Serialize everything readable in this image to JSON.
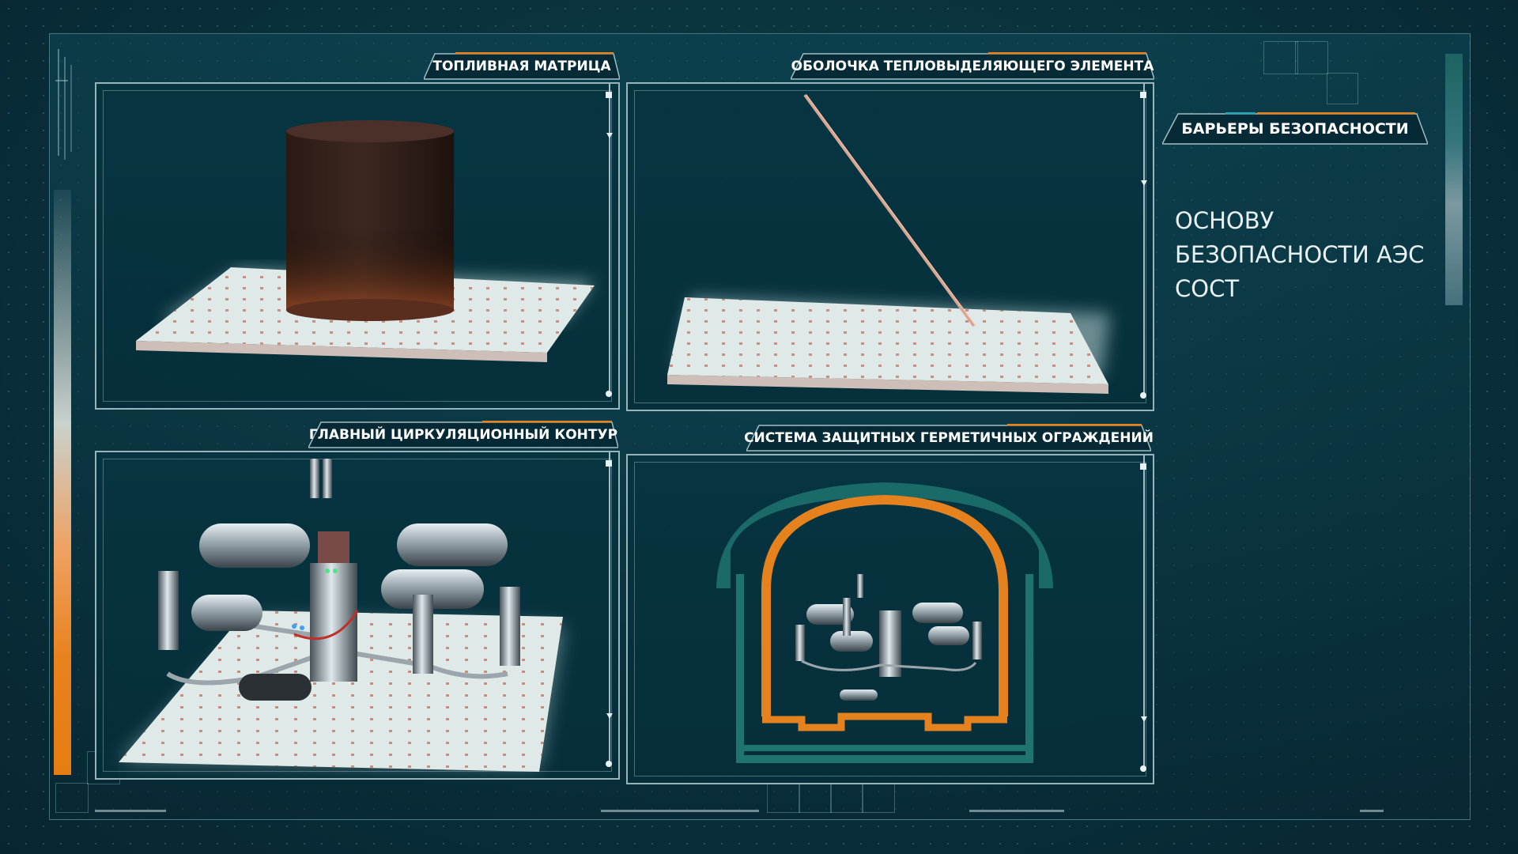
{
  "panels": {
    "fuel_matrix": {
      "title": "ТОПЛИВНАЯ МАТРИЦА"
    },
    "fuel_cladding": {
      "title": "ОБОЛОЧКА ТЕПЛОВЫДЕЛЯЮЩЕГО ЭЛЕМЕНТА"
    },
    "primary_circuit": {
      "title": "ГЛАВНЫЙ ЦИРКУЛЯЦИОННЫЙ КОНТУР"
    },
    "containment": {
      "title": "СИСТЕМА ЗАЩИТНЫХ ГЕРМЕТИЧНЫХ ОГРАЖДЕНИЙ"
    }
  },
  "sidebar": {
    "heading": "БАРЬЕРЫ БЕЗОПАСНОСТИ",
    "description": "ОСНОВУ БЕЗОПАСНОСТИ АЭС СОСТ"
  },
  "colors": {
    "accent_orange": "#e8821e",
    "background": "#0a3440",
    "teal_line": "#2aa6b8"
  }
}
